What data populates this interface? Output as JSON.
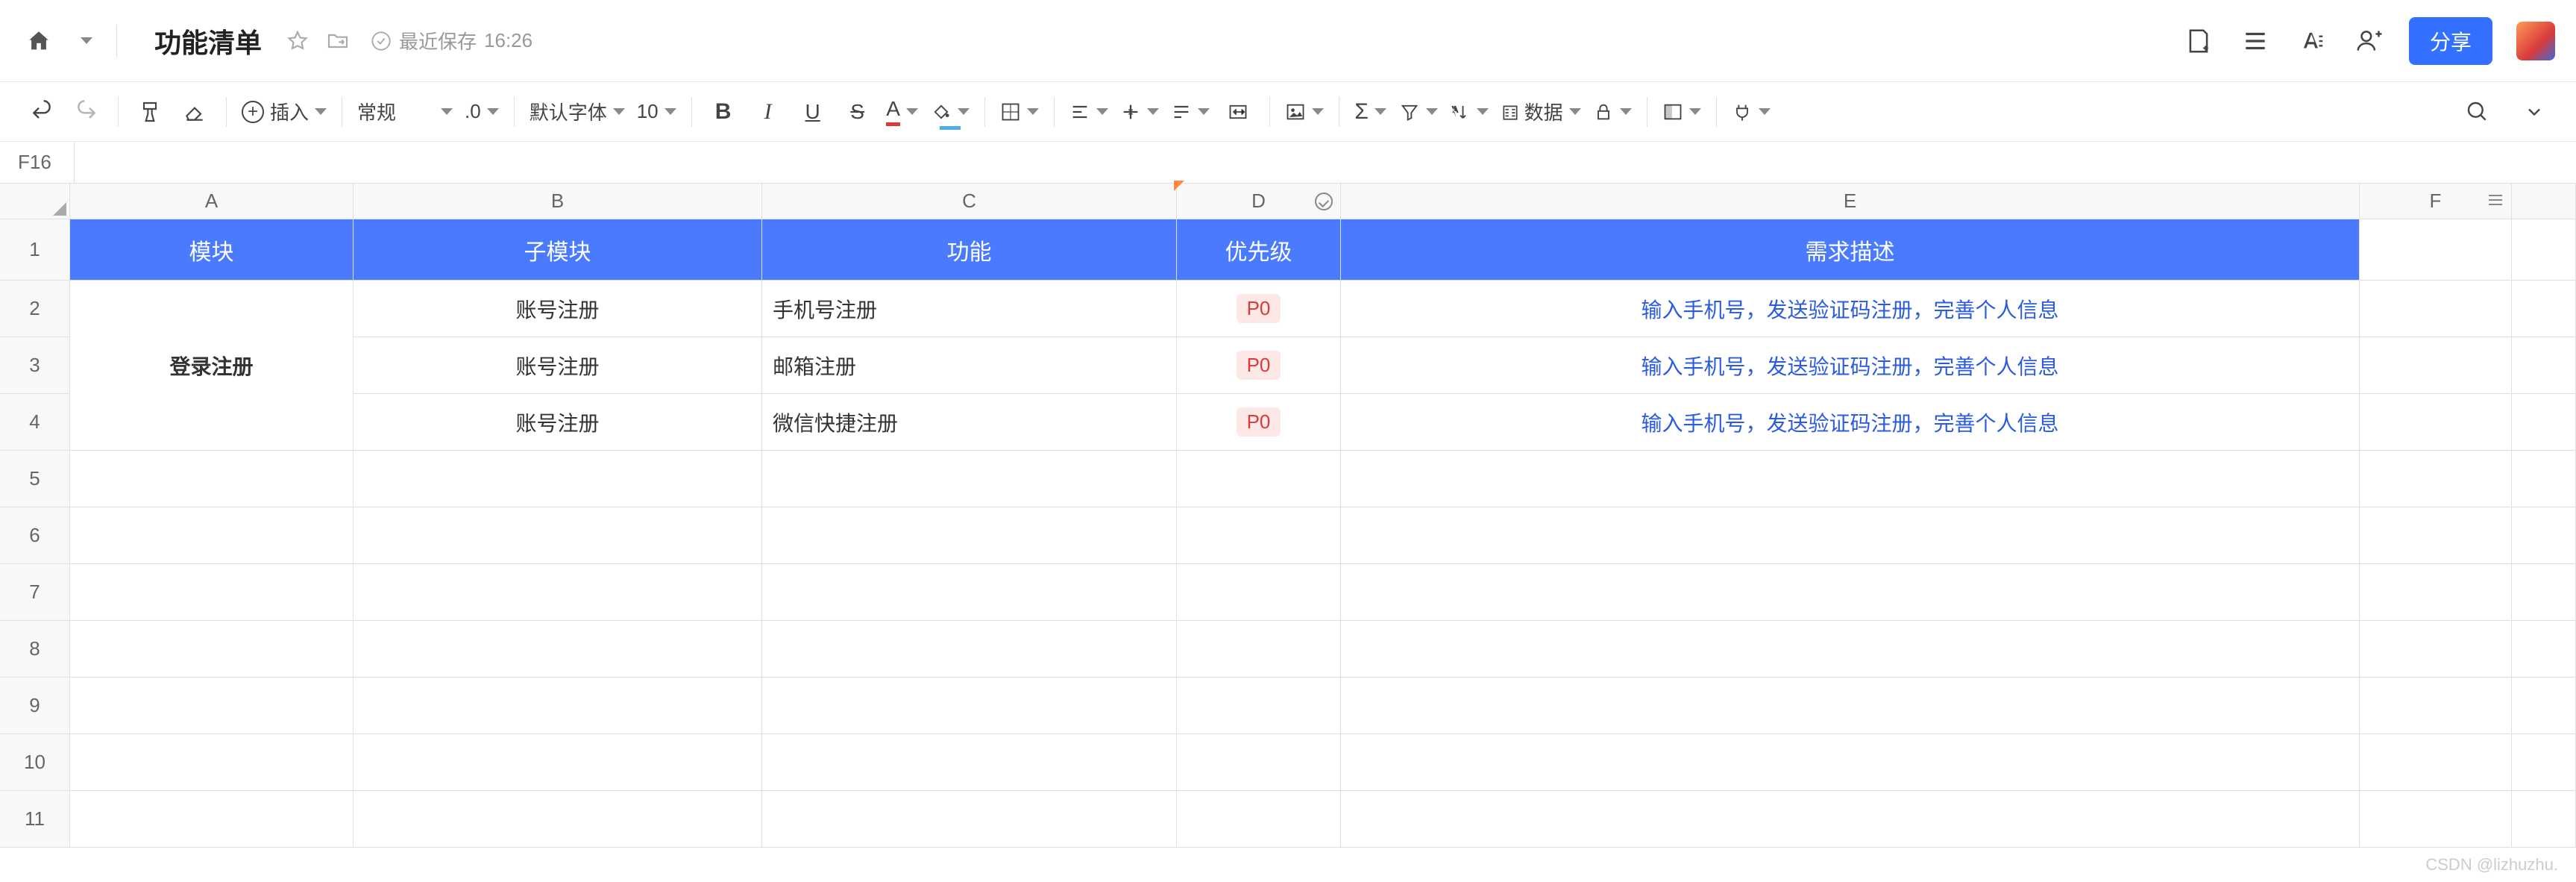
{
  "header": {
    "doc_title": "功能清单",
    "save_status_label": "最近保存",
    "save_time": "16:26",
    "share_label": "分享"
  },
  "toolbar": {
    "insert_label": "插入",
    "format_label": "常规",
    "decimal_label": ".0",
    "font_label": "默认字体",
    "font_size": "10",
    "data_label": "数据"
  },
  "namebox": {
    "ref": "F16"
  },
  "columns": [
    "A",
    "B",
    "C",
    "D",
    "E",
    "F"
  ],
  "header_row": {
    "A": "模块",
    "B": "子模块",
    "C": "功能",
    "D": "优先级",
    "E": "需求描述"
  },
  "rows": [
    {
      "n": 2,
      "B": "账号注册",
      "C": "手机号注册",
      "D": "P0",
      "E": "输入手机号，发送验证码注册，完善个人信息"
    },
    {
      "n": 3,
      "B": "账号注册",
      "C": "邮箱注册",
      "D": "P0",
      "E": "输入手机号，发送验证码注册，完善个人信息"
    },
    {
      "n": 4,
      "B": "账号注册",
      "C": "微信快捷注册",
      "D": "P0",
      "E": "输入手机号，发送验证码注册，完善个人信息"
    }
  ],
  "merged_a": "登录注册",
  "empty_rows": [
    5,
    6,
    7,
    8,
    9,
    10,
    11
  ],
  "watermark": "CSDN @lizhuzhu."
}
